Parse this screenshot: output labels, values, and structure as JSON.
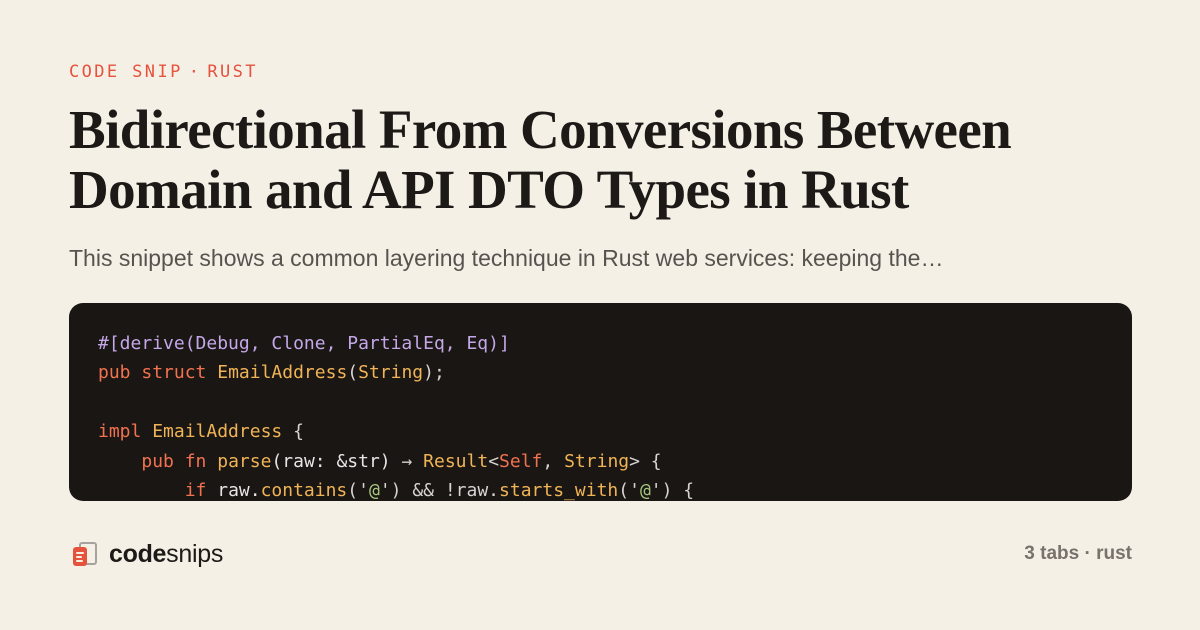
{
  "kicker": {
    "left": "CODE SNIP",
    "sep": "·",
    "right": "RUST"
  },
  "title": "Bidirectional From Conversions Between Domain and API DTO Types in Rust",
  "subtitle": "This snippet shows a common layering technique in Rust web services: keeping the…",
  "code": {
    "language": "rust",
    "lines": [
      [
        {
          "t": "#[derive(Debug, Clone, PartialEq, Eq)]",
          "c": "attr"
        }
      ],
      [
        {
          "t": "pub",
          "c": "kw"
        },
        {
          "t": " ",
          "c": "plain"
        },
        {
          "t": "struct",
          "c": "kw"
        },
        {
          "t": " ",
          "c": "plain"
        },
        {
          "t": "EmailAddress",
          "c": "type"
        },
        {
          "t": "(",
          "c": "punc"
        },
        {
          "t": "String",
          "c": "type"
        },
        {
          "t": ");",
          "c": "punc"
        }
      ],
      [],
      [
        {
          "t": "impl",
          "c": "kw"
        },
        {
          "t": " ",
          "c": "plain"
        },
        {
          "t": "EmailAddress",
          "c": "type"
        },
        {
          "t": " {",
          "c": "punc"
        }
      ],
      [
        {
          "t": "    ",
          "c": "plain"
        },
        {
          "t": "pub",
          "c": "kw"
        },
        {
          "t": " ",
          "c": "plain"
        },
        {
          "t": "fn",
          "c": "kw"
        },
        {
          "t": " ",
          "c": "plain"
        },
        {
          "t": "parse",
          "c": "fn"
        },
        {
          "t": "(raw: &str) ",
          "c": "plain"
        },
        {
          "t": "→",
          "c": "punc"
        },
        {
          "t": " ",
          "c": "plain"
        },
        {
          "t": "Result",
          "c": "type"
        },
        {
          "t": "<",
          "c": "punc"
        },
        {
          "t": "Self",
          "c": "kw"
        },
        {
          "t": ", ",
          "c": "punc"
        },
        {
          "t": "String",
          "c": "type"
        },
        {
          "t": "> {",
          "c": "punc"
        }
      ],
      [
        {
          "t": "        ",
          "c": "plain"
        },
        {
          "t": "if",
          "c": "kw"
        },
        {
          "t": " raw.",
          "c": "plain"
        },
        {
          "t": "contains",
          "c": "fn"
        },
        {
          "t": "('",
          "c": "punc"
        },
        {
          "t": "@",
          "c": "str"
        },
        {
          "t": "') && !raw.",
          "c": "punc"
        },
        {
          "t": "starts_with",
          "c": "fn"
        },
        {
          "t": "('",
          "c": "punc"
        },
        {
          "t": "@",
          "c": "str"
        },
        {
          "t": "') {",
          "c": "punc"
        }
      ]
    ]
  },
  "footer": {
    "brand_bold": "code",
    "brand_regular": "snips",
    "logo_icon": "snippet-stack-icon",
    "meta": "3 tabs · rust"
  },
  "colors": {
    "background": "#f5f0e6",
    "accent": "#e5533d",
    "code_background": "#1a1614"
  }
}
